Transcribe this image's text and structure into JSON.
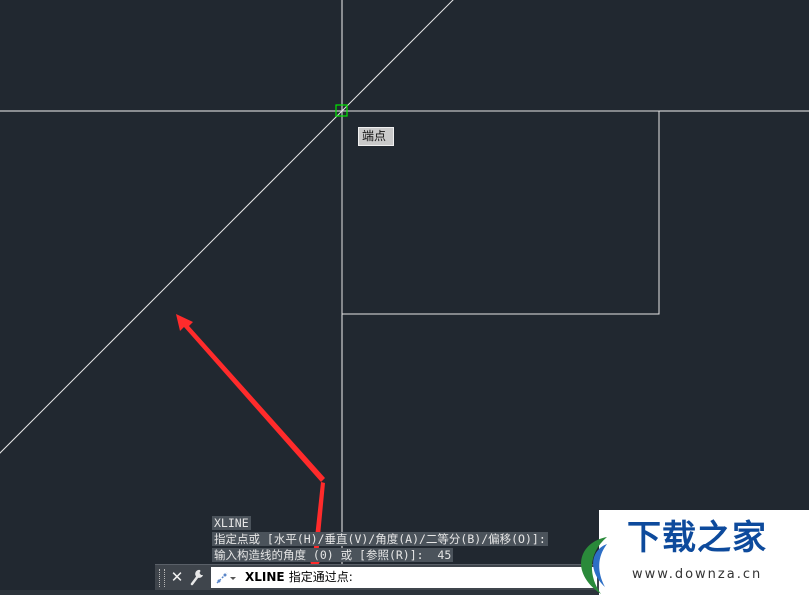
{
  "tooltip": {
    "snap_label": "端点"
  },
  "command_history": [
    "XLINE",
    "指定点或 [水平(H)/垂直(V)/角度(A)/二等分(B)/偏移(O)]:",
    "输入构造线的角度 (0) 或 [参照(R)]:  45"
  ],
  "command_line": {
    "command": "XLINE",
    "prompt": "指定通过点:",
    "close_glyph": "✕",
    "icons": [
      "grip-handle",
      "close-icon",
      "wrench-icon",
      "command-icon"
    ]
  },
  "watermark": {
    "name": "下载之家",
    "url": "www.downza.cn"
  },
  "colors": {
    "background": "#212830",
    "geometry": "#ffffff",
    "snap_marker": "#00ff00",
    "arrow": "#ff3030",
    "logo_blue": "#0d4a9c"
  }
}
